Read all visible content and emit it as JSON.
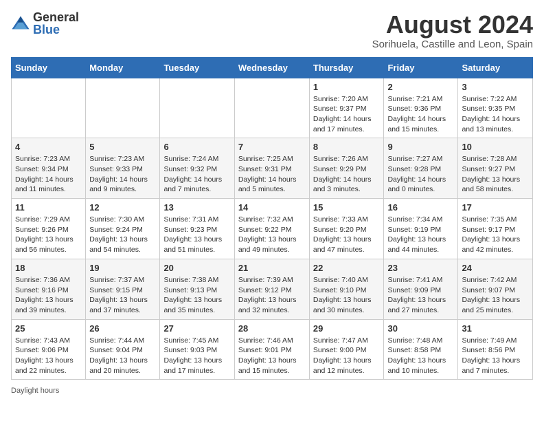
{
  "header": {
    "logo_general": "General",
    "logo_blue": "Blue",
    "title": "August 2024",
    "subtitle": "Sorihuela, Castille and Leon, Spain"
  },
  "calendar": {
    "days_of_week": [
      "Sunday",
      "Monday",
      "Tuesday",
      "Wednesday",
      "Thursday",
      "Friday",
      "Saturday"
    ],
    "weeks": [
      [
        {
          "day": "",
          "info": ""
        },
        {
          "day": "",
          "info": ""
        },
        {
          "day": "",
          "info": ""
        },
        {
          "day": "",
          "info": ""
        },
        {
          "day": "1",
          "info": "Sunrise: 7:20 AM\nSunset: 9:37 PM\nDaylight: 14 hours and 17 minutes."
        },
        {
          "day": "2",
          "info": "Sunrise: 7:21 AM\nSunset: 9:36 PM\nDaylight: 14 hours and 15 minutes."
        },
        {
          "day": "3",
          "info": "Sunrise: 7:22 AM\nSunset: 9:35 PM\nDaylight: 14 hours and 13 minutes."
        }
      ],
      [
        {
          "day": "4",
          "info": "Sunrise: 7:23 AM\nSunset: 9:34 PM\nDaylight: 14 hours and 11 minutes."
        },
        {
          "day": "5",
          "info": "Sunrise: 7:23 AM\nSunset: 9:33 PM\nDaylight: 14 hours and 9 minutes."
        },
        {
          "day": "6",
          "info": "Sunrise: 7:24 AM\nSunset: 9:32 PM\nDaylight: 14 hours and 7 minutes."
        },
        {
          "day": "7",
          "info": "Sunrise: 7:25 AM\nSunset: 9:31 PM\nDaylight: 14 hours and 5 minutes."
        },
        {
          "day": "8",
          "info": "Sunrise: 7:26 AM\nSunset: 9:29 PM\nDaylight: 14 hours and 3 minutes."
        },
        {
          "day": "9",
          "info": "Sunrise: 7:27 AM\nSunset: 9:28 PM\nDaylight: 14 hours and 0 minutes."
        },
        {
          "day": "10",
          "info": "Sunrise: 7:28 AM\nSunset: 9:27 PM\nDaylight: 13 hours and 58 minutes."
        }
      ],
      [
        {
          "day": "11",
          "info": "Sunrise: 7:29 AM\nSunset: 9:26 PM\nDaylight: 13 hours and 56 minutes."
        },
        {
          "day": "12",
          "info": "Sunrise: 7:30 AM\nSunset: 9:24 PM\nDaylight: 13 hours and 54 minutes."
        },
        {
          "day": "13",
          "info": "Sunrise: 7:31 AM\nSunset: 9:23 PM\nDaylight: 13 hours and 51 minutes."
        },
        {
          "day": "14",
          "info": "Sunrise: 7:32 AM\nSunset: 9:22 PM\nDaylight: 13 hours and 49 minutes."
        },
        {
          "day": "15",
          "info": "Sunrise: 7:33 AM\nSunset: 9:20 PM\nDaylight: 13 hours and 47 minutes."
        },
        {
          "day": "16",
          "info": "Sunrise: 7:34 AM\nSunset: 9:19 PM\nDaylight: 13 hours and 44 minutes."
        },
        {
          "day": "17",
          "info": "Sunrise: 7:35 AM\nSunset: 9:17 PM\nDaylight: 13 hours and 42 minutes."
        }
      ],
      [
        {
          "day": "18",
          "info": "Sunrise: 7:36 AM\nSunset: 9:16 PM\nDaylight: 13 hours and 39 minutes."
        },
        {
          "day": "19",
          "info": "Sunrise: 7:37 AM\nSunset: 9:15 PM\nDaylight: 13 hours and 37 minutes."
        },
        {
          "day": "20",
          "info": "Sunrise: 7:38 AM\nSunset: 9:13 PM\nDaylight: 13 hours and 35 minutes."
        },
        {
          "day": "21",
          "info": "Sunrise: 7:39 AM\nSunset: 9:12 PM\nDaylight: 13 hours and 32 minutes."
        },
        {
          "day": "22",
          "info": "Sunrise: 7:40 AM\nSunset: 9:10 PM\nDaylight: 13 hours and 30 minutes."
        },
        {
          "day": "23",
          "info": "Sunrise: 7:41 AM\nSunset: 9:09 PM\nDaylight: 13 hours and 27 minutes."
        },
        {
          "day": "24",
          "info": "Sunrise: 7:42 AM\nSunset: 9:07 PM\nDaylight: 13 hours and 25 minutes."
        }
      ],
      [
        {
          "day": "25",
          "info": "Sunrise: 7:43 AM\nSunset: 9:06 PM\nDaylight: 13 hours and 22 minutes."
        },
        {
          "day": "26",
          "info": "Sunrise: 7:44 AM\nSunset: 9:04 PM\nDaylight: 13 hours and 20 minutes."
        },
        {
          "day": "27",
          "info": "Sunrise: 7:45 AM\nSunset: 9:03 PM\nDaylight: 13 hours and 17 minutes."
        },
        {
          "day": "28",
          "info": "Sunrise: 7:46 AM\nSunset: 9:01 PM\nDaylight: 13 hours and 15 minutes."
        },
        {
          "day": "29",
          "info": "Sunrise: 7:47 AM\nSunset: 9:00 PM\nDaylight: 13 hours and 12 minutes."
        },
        {
          "day": "30",
          "info": "Sunrise: 7:48 AM\nSunset: 8:58 PM\nDaylight: 13 hours and 10 minutes."
        },
        {
          "day": "31",
          "info": "Sunrise: 7:49 AM\nSunset: 8:56 PM\nDaylight: 13 hours and 7 minutes."
        }
      ]
    ]
  },
  "footer": {
    "daylight_hours_label": "Daylight hours"
  }
}
